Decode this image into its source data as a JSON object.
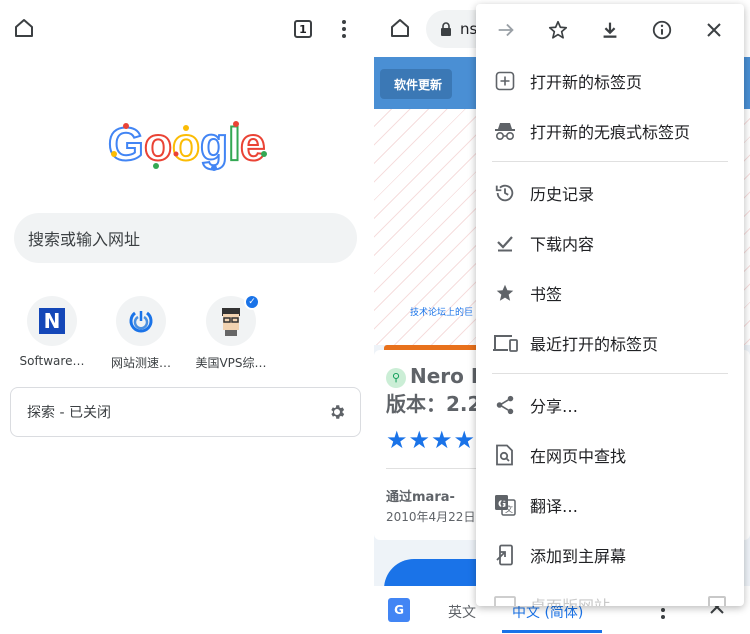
{
  "left": {
    "tab_count": "1",
    "search_placeholder": "搜索或输入网址",
    "tiles": [
      {
        "label": "Software…",
        "icon": "N"
      },
      {
        "label": "网站测速…",
        "icon": "speed"
      },
      {
        "label": "美国VPS综…",
        "icon": "avatar"
      }
    ],
    "explore_label": "探索 - 已关闭"
  },
  "right": {
    "url_text": "ns",
    "page": {
      "update_tag": "软件更新",
      "hero_text": "技术论坛上的巨",
      "title_line1": "Nero L",
      "title_line2": "版本：2.2",
      "stars": "★★★★",
      "by": "通过mara-",
      "date": "2010年4月22日"
    },
    "translate": {
      "source": "英文",
      "target": "中文 (简体)"
    }
  },
  "menu": {
    "items": [
      {
        "label": "打开新的标签页",
        "icon": "new-tab-icon"
      },
      {
        "label": "打开新的无痕式标签页",
        "icon": "incognito-icon"
      },
      {
        "label": "历史记录",
        "icon": "history-icon"
      },
      {
        "label": "下载内容",
        "icon": "downloads-icon"
      },
      {
        "label": "书签",
        "icon": "bookmarks-icon"
      },
      {
        "label": "最近打开的标签页",
        "icon": "recent-tabs-icon"
      },
      {
        "label": "分享…",
        "icon": "share-icon"
      },
      {
        "label": "在网页中查找",
        "icon": "find-in-page-icon"
      },
      {
        "label": "翻译…",
        "icon": "translate-icon"
      },
      {
        "label": "添加到主屏幕",
        "icon": "add-to-home-icon"
      },
      {
        "label": "桌面版网站",
        "icon": "desktop-site-icon"
      }
    ]
  },
  "colors": {
    "accent": "#1a73e8",
    "icon": "#5f6368"
  }
}
